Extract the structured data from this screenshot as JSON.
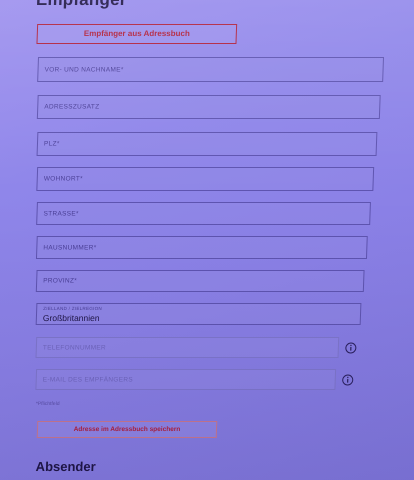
{
  "recipient_section": {
    "title": "Empfänger",
    "address_book_button": "Empfänger aus Adressbuch"
  },
  "form": {
    "full_name": "VOR- UND NACHNAME*",
    "address_supplement": "ADRESSZUSATZ",
    "postal_code": "PLZ*",
    "city": "WOHNORT*",
    "street": "STRASSE*",
    "house_number": "HAUSNUMMER*",
    "province": "PROVINZ*",
    "country_label": "ZIELLAND / ZIELREGION",
    "country_value": "Großbritannien",
    "phone": "TELEFONNUMMER",
    "email": "E-MAIL DES EMPFÄNGERS",
    "required_hint": "*Pflichtfeld",
    "save_button": "Adresse im Adressbuch speichern"
  },
  "sender_section": {
    "title": "Absender"
  },
  "icons": {
    "phone_info": "info-icon",
    "email_info": "info-icon"
  },
  "colors": {
    "accent": "#b0213d",
    "field_border": "#5e54b0",
    "heading": "#1f1646"
  }
}
